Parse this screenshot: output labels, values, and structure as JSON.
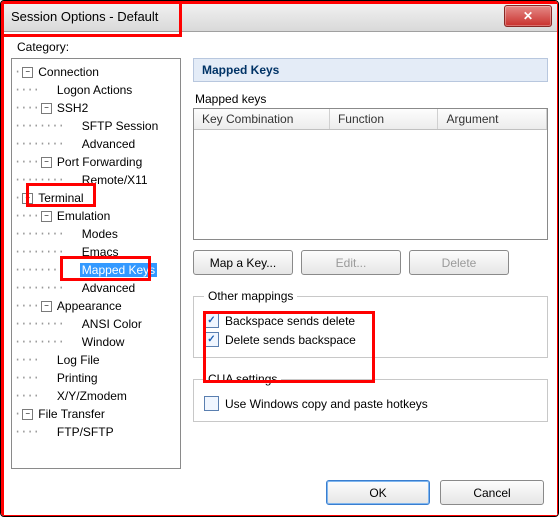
{
  "window": {
    "title": "Session Options - Default"
  },
  "category_label": "Category:",
  "tree": {
    "connection": "Connection",
    "logon_actions": "Logon Actions",
    "ssh2": "SSH2",
    "sftp_session": "SFTP Session",
    "ssh2_advanced": "Advanced",
    "port_forwarding": "Port Forwarding",
    "remote_x11": "Remote/X11",
    "terminal": "Terminal",
    "emulation": "Emulation",
    "modes": "Modes",
    "emacs": "Emacs",
    "mapped_keys": "Mapped Keys",
    "emu_advanced": "Advanced",
    "appearance": "Appearance",
    "ansi_color": "ANSI Color",
    "window_item": "Window",
    "log_file": "Log File",
    "printing": "Printing",
    "xyzmodem": "X/Y/Zmodem",
    "file_transfer": "File Transfer",
    "ftp_sftp": "FTP/SFTP"
  },
  "panel": {
    "header": "Mapped Keys",
    "mapped_keys_label": "Mapped keys",
    "columns": {
      "key": "Key Combination",
      "func": "Function",
      "arg": "Argument"
    },
    "buttons": {
      "map": "Map a Key...",
      "edit": "Edit...",
      "delete": "Delete"
    },
    "other_mappings": {
      "legend": "Other mappings",
      "backspace": "Backspace sends delete",
      "delete": "Delete sends backspace"
    },
    "cua": {
      "legend": "CUA settings",
      "hotkeys": "Use Windows copy and paste hotkeys"
    }
  },
  "dialog": {
    "ok": "OK",
    "cancel": "Cancel"
  }
}
